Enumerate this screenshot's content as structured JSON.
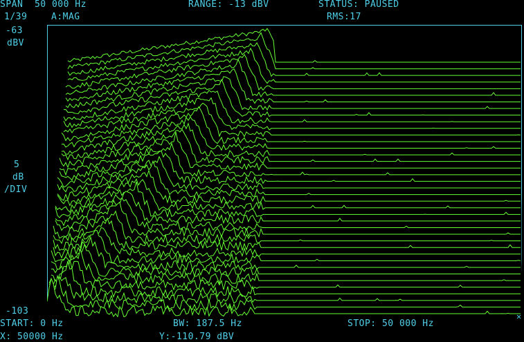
{
  "header": {
    "span": "SPAN  50 000 Hz",
    "range": "RANGE: -13 dBV",
    "status": "STATUS: PAUSED",
    "trace_index": "1/39",
    "channel": "A:MAG",
    "rms": "RMS:17"
  },
  "y_scale": {
    "top_value": "-63",
    "top_unit": "dBV",
    "scale_value": "5",
    "scale_unit": "dB",
    "scale_per": "/DIV",
    "bottom_value": "-103"
  },
  "footer": {
    "start": "START: 0 Hz",
    "bandwidth": "BW: 187.5 Hz",
    "stop": "STOP: 50 000 Hz",
    "cursor_x": "X: 50000 Hz",
    "cursor_y": "Y:-110.79 dBV"
  },
  "colors": {
    "text": "#4fd0e8",
    "trace": "#66ff33",
    "background": "#000000"
  },
  "chart_data": {
    "type": "line",
    "subtype": "waterfall",
    "trace_count": 39,
    "x_range_hz": [
      0,
      50000
    ],
    "y_range_dbv": [
      -103,
      -63
    ],
    "scale_db_per_div": 5,
    "sweep_peak_start_hz": 0,
    "sweep_peak_end_hz": 22000,
    "noise_floor_cutoff_hz": 22000,
    "grid": false
  }
}
